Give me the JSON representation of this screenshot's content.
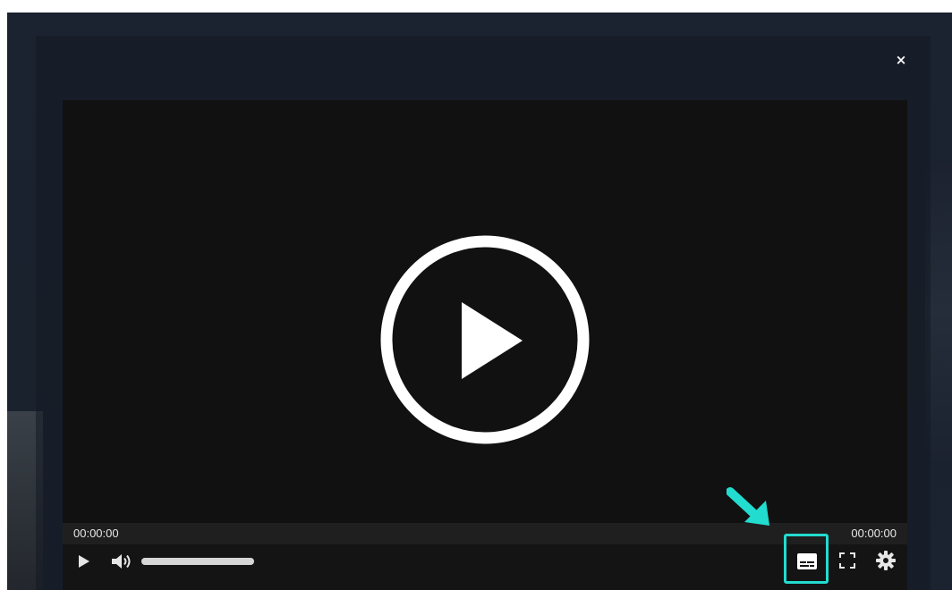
{
  "modal": {
    "close_label": "×"
  },
  "player": {
    "big_play_icon": "play-circle-icon",
    "time_current": "00:00:00",
    "time_total": "00:00:00",
    "volume_level": 1.0,
    "controls": {
      "play_icon": "play-icon",
      "volume_icon": "volume-icon",
      "captions_icon": "captions-icon",
      "fullscreen_icon": "fullscreen-icon",
      "settings_icon": "gear-icon"
    }
  },
  "annotation": {
    "highlight_color": "#22dccf",
    "arrow_icon": "arrow-down-right-icon"
  }
}
